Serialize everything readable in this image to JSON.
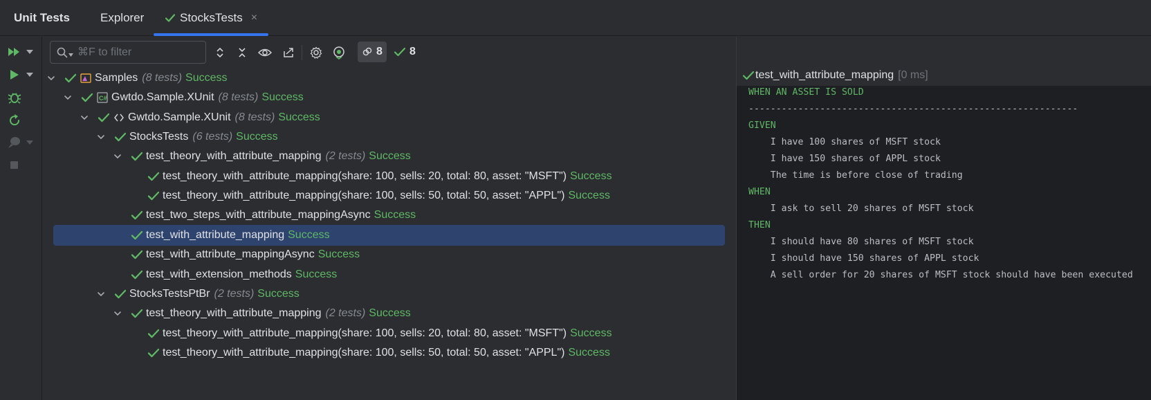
{
  "tabs": {
    "title": "Unit Tests",
    "explorer": "Explorer",
    "active": "StocksTests",
    "close": "×"
  },
  "filter": {
    "placeholder": "⌘F to filter"
  },
  "counters": {
    "ignored": "8",
    "passed": "8"
  },
  "tree": [
    {
      "depth": 0,
      "expanded": true,
      "kind": "samples",
      "name": "Samples",
      "count": "(8 tests)",
      "status": "Success"
    },
    {
      "depth": 1,
      "expanded": true,
      "kind": "csharp",
      "name": "Gwtdo.Sample.XUnit",
      "count": "(8 tests)",
      "status": "Success"
    },
    {
      "depth": 2,
      "expanded": true,
      "kind": "namespace",
      "name": "Gwtdo.Sample.XUnit",
      "count": "(8 tests)",
      "status": "Success"
    },
    {
      "depth": 3,
      "expanded": true,
      "kind": "none",
      "name": "StocksTests",
      "count": "(6 tests)",
      "status": "Success"
    },
    {
      "depth": 4,
      "expanded": true,
      "kind": "none",
      "name": "test_theory_with_attribute_mapping",
      "count": "(2 tests)",
      "status": "Success"
    },
    {
      "depth": 5,
      "expanded": null,
      "kind": "none",
      "name": "test_theory_with_attribute_mapping(share: 100, sells: 20, total: 80, asset: \"MSFT\")",
      "count": "",
      "status": "Success"
    },
    {
      "depth": 5,
      "expanded": null,
      "kind": "none",
      "name": "test_theory_with_attribute_mapping(share: 100, sells: 50, total: 50, asset: \"APPL\")",
      "count": "",
      "status": "Success"
    },
    {
      "depth": 4,
      "expanded": null,
      "kind": "none",
      "name": "test_two_steps_with_attribute_mappingAsync",
      "count": "",
      "status": "Success"
    },
    {
      "depth": 4,
      "expanded": null,
      "kind": "none",
      "name": "test_with_attribute_mapping",
      "count": "",
      "status": "Success",
      "selected": true
    },
    {
      "depth": 4,
      "expanded": null,
      "kind": "none",
      "name": "test_with_attribute_mappingAsync",
      "count": "",
      "status": "Success"
    },
    {
      "depth": 4,
      "expanded": null,
      "kind": "none",
      "name": "test_with_extension_methods",
      "count": "",
      "status": "Success"
    },
    {
      "depth": 3,
      "expanded": true,
      "kind": "none",
      "name": "StocksTestsPtBr",
      "count": "(2 tests)",
      "status": "Success"
    },
    {
      "depth": 4,
      "expanded": true,
      "kind": "none",
      "name": "test_theory_with_attribute_mapping",
      "count": "(2 tests)",
      "status": "Success"
    },
    {
      "depth": 5,
      "expanded": null,
      "kind": "none",
      "name": "test_theory_with_attribute_mapping(share: 100, sells: 20, total: 80, asset: \"MSFT\")",
      "count": "",
      "status": "Success"
    },
    {
      "depth": 5,
      "expanded": null,
      "kind": "none",
      "name": "test_theory_with_attribute_mapping(share: 100, sells: 50, total: 50, asset: \"APPL\")",
      "count": "",
      "status": "Success"
    }
  ],
  "output": {
    "title": "test_with_attribute_mapping",
    "duration": "[0 ms]",
    "lines": [
      {
        "text": "WHEN AN ASSET IS SOLD",
        "keyword": true
      },
      {
        "text": "------------------------------------------------------------",
        "keyword": false
      },
      {
        "text": "GIVEN",
        "keyword": true
      },
      {
        "text": "    I have 100 shares of MSFT stock",
        "keyword": false
      },
      {
        "text": "    I have 150 shares of APPL stock",
        "keyword": false
      },
      {
        "text": "    The time is before close of trading",
        "keyword": false
      },
      {
        "text": "WHEN",
        "keyword": true
      },
      {
        "text": "    I ask to sell 20 shares of MSFT stock",
        "keyword": false
      },
      {
        "text": "THEN",
        "keyword": true
      },
      {
        "text": "    I should have 80 shares of MSFT stock",
        "keyword": false
      },
      {
        "text": "    I should have 150 shares of APPL stock",
        "keyword": false
      },
      {
        "text": "    A sell order for 20 shares of MSFT stock should have been executed",
        "keyword": false
      }
    ]
  },
  "colors": {
    "success": "#5fb865",
    "accent": "#3574f0",
    "selection": "#2e436e"
  }
}
